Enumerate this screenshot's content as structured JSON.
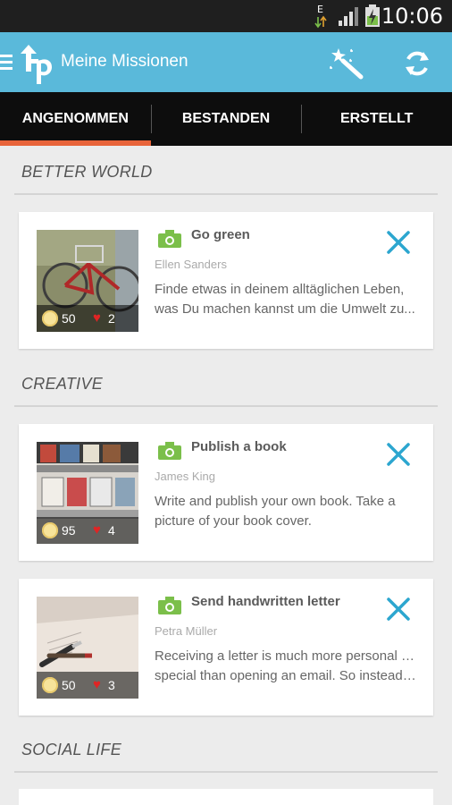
{
  "status": {
    "time": "10:06",
    "data_indicator": "E"
  },
  "appbar": {
    "title": "Meine Missionen",
    "logo_text": "tp"
  },
  "tabs": [
    {
      "label": "ANGENOMMEN",
      "active": true
    },
    {
      "label": "BESTANDEN",
      "active": false
    },
    {
      "label": "ERSTELLT",
      "active": false
    }
  ],
  "sections": [
    {
      "label": "BETTER WORLD"
    },
    {
      "label": "CREATIVE"
    },
    {
      "label": "SOCIAL LIFE"
    }
  ],
  "missions": [
    {
      "title": "Go green",
      "author": "Ellen Sanders",
      "desc_line1": "Finde etwas in deinem alltäglichen Leben,",
      "desc_line2": "was Du machen kannst um die Umwelt zu...",
      "points": "50",
      "likes": "2",
      "image": "bicycle-photo"
    },
    {
      "title": "Publish a book",
      "author": "James King",
      "desc_line1": "Write and publish your own book. Take a",
      "desc_line2": "picture of your book cover.",
      "points": "95",
      "likes": "4",
      "image": "bookshelf-photo"
    },
    {
      "title": "Send handwritten letter",
      "author": "Petra Müller",
      "desc_line1": "Receiving a letter is much more personal and",
      "desc_line2": "special than opening an email. So instead o...",
      "points": "50",
      "likes": "3",
      "image": "pen-on-paper-photo"
    }
  ],
  "colors": {
    "appbar": "#5ab9da",
    "tab_indicator": "#e8643a",
    "accent": "#2ca6cf",
    "camera": "#7bbf4a"
  }
}
